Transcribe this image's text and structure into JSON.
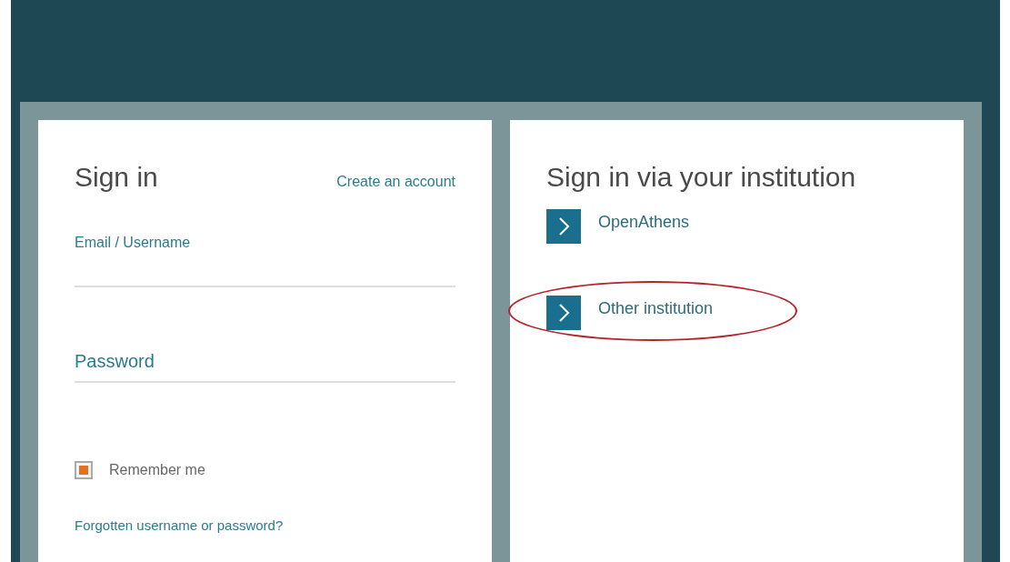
{
  "sign_in": {
    "title": "Sign in",
    "create_account_link": "Create an account",
    "fields": [
      {
        "label": "Email / Username",
        "kind": "small"
      },
      {
        "label": "Password",
        "kind": "large"
      }
    ],
    "remember_me": {
      "label": "Remember me",
      "checked": true
    },
    "forgot_link": "Forgotten username or password?"
  },
  "institution": {
    "title": "Sign in via your institution",
    "options": [
      {
        "label": "OpenAthens",
        "circled": false
      },
      {
        "label": "Other institution",
        "circled": true
      }
    ]
  }
}
